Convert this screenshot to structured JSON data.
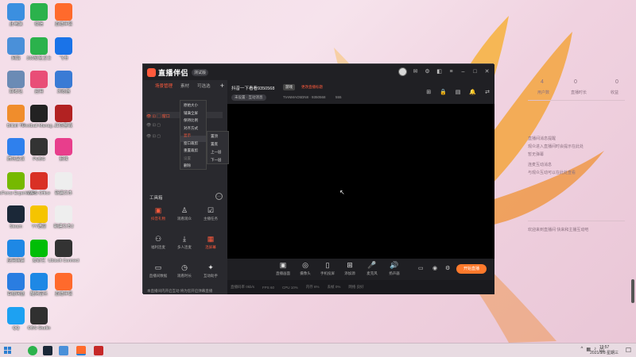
{
  "desktop_icons": [
    {
      "label": "此电脑",
      "icon": "computer-icon",
      "color": "#3b8fe0"
    },
    {
      "label": "微信",
      "icon": "wechat-icon",
      "color": "#2bb24c"
    },
    {
      "label": "直播伴侣",
      "icon": "live-companion-icon",
      "color": "#ff6a2c"
    },
    {
      "label": "网络",
      "icon": "network-icon",
      "color": "#4a90d9"
    },
    {
      "label": "360安全卫士",
      "icon": "shield-icon",
      "color": "#2bb24c"
    },
    {
      "label": "飞书",
      "icon": "feishu-icon",
      "color": "#1a73e8"
    },
    {
      "label": "回收站",
      "icon": "recycle-bin-icon",
      "color": "#6b8bb5"
    },
    {
      "label": "应用",
      "icon": "app-icon",
      "color": "#e94e77"
    },
    {
      "label": "浏览器",
      "icon": "browser-icon",
      "color": "#3a7bd5"
    },
    {
      "label": "Bilibili TV",
      "icon": "bilibili-icon",
      "color": "#f08d2c"
    },
    {
      "label": "Football Manag...",
      "icon": "football-icon",
      "color": "#222222"
    },
    {
      "label": "红色警戒",
      "icon": "game-icon",
      "color": "#b22222"
    },
    {
      "label": "腾讯会议",
      "icon": "meeting-icon",
      "color": "#2f80ed"
    },
    {
      "label": "PUBG",
      "icon": "pubg-icon",
      "color": "#333333"
    },
    {
      "label": "剪映",
      "icon": "capcut-icon",
      "color": "#e83e8c"
    },
    {
      "label": "GeForce Experience",
      "icon": "nvidia-icon",
      "color": "#76b900"
    },
    {
      "label": "WPS Office",
      "icon": "wps-icon",
      "color": "#d93025"
    },
    {
      "label": "新建文本",
      "icon": "document-icon",
      "color": "#eeeeee"
    },
    {
      "label": "Steam",
      "icon": "steam-icon",
      "color": "#1b2838"
    },
    {
      "label": "YY语音",
      "icon": "yy-icon",
      "color": "#f5c400"
    },
    {
      "label": "新建文本2",
      "icon": "document-icon",
      "color": "#eeeeee"
    },
    {
      "label": "应用商店",
      "icon": "store-icon",
      "color": "#1e88e5"
    },
    {
      "label": "爱奇艺",
      "icon": "iqiyi-icon",
      "color": "#00be06"
    },
    {
      "label": "Ubisoft Connect",
      "icon": "ubisoft-icon",
      "color": "#333333"
    },
    {
      "label": "百度网盘",
      "icon": "cloud-icon",
      "color": "#2a7de1"
    },
    {
      "label": "酷狗音乐",
      "icon": "kugou-icon",
      "color": "#1e88e5"
    },
    {
      "label": "直播伴侣",
      "icon": "live-companion-icon",
      "color": "#ff6a2c"
    },
    {
      "label": "QQ",
      "icon": "qq-icon",
      "color": "#1da1f2"
    },
    {
      "label": "OBS Studio",
      "icon": "obs-icon",
      "color": "#303030"
    }
  ],
  "app": {
    "logo_text": "直播伴侣",
    "version_badge": "测试版",
    "left_tabs": [
      "场景管理",
      "素材",
      "可选选"
    ],
    "tools_title": "工具箱",
    "tools": [
      {
        "label": "抖音礼物",
        "icon": "gift-icon",
        "active": true
      },
      {
        "label": "观看观众",
        "icon": "user-icon",
        "active": false
      },
      {
        "label": "主播任务",
        "icon": "task-icon",
        "active": false
      },
      {
        "label": "福利连麦",
        "icon": "link-icon",
        "active": false
      },
      {
        "label": "多人连麦",
        "icon": "download-icon",
        "active": false
      },
      {
        "label": "连屏幕",
        "icon": "screen-icon",
        "active": true
      },
      {
        "label": "直播间数据",
        "icon": "stats-icon",
        "active": false
      },
      {
        "label": "观看时长",
        "icon": "clock-icon",
        "active": false
      },
      {
        "label": "互动助手",
        "icon": "helper-icon",
        "active": false
      }
    ],
    "context_menu": [
      "原始大小",
      "铺满全屏",
      "保持比例",
      "对齐方式",
      "显示",
      "窗口裁剪",
      "重置裁剪",
      "设置",
      "删除"
    ],
    "submenu": [
      "置顶",
      "置底",
      "上一层",
      "下一层"
    ],
    "room_title": "抖音一下看看9350568",
    "category_badge": "游戏",
    "red_badge": "更改直播标题",
    "sub_pill": "未设置 · 互动消息",
    "room_id": "TIANMAO5DN8 · 9350568",
    "heat_label": "555",
    "bottom_tools": [
      {
        "label": "直播画面",
        "icon": "display-icon"
      },
      {
        "label": "摄像头",
        "icon": "camera-icon"
      },
      {
        "label": "手机投屏",
        "icon": "phone-icon"
      },
      {
        "label": "添加源",
        "icon": "add-source-icon"
      },
      {
        "label": "麦克风",
        "icon": "mic-icon"
      },
      {
        "label": "扬声器",
        "icon": "speaker-icon"
      }
    ],
    "start_button": "开始直播",
    "status_items": [
      "直播码率 0kb/s",
      "FPS 60",
      "CPU 10%",
      "内存 6%",
      "丢帧 0%",
      "网络 良好"
    ],
    "left_footer": "本直播间内开启互动 将为您开启弹幕直播"
  },
  "right_panel": {
    "stats": [
      "4",
      "0",
      "0"
    ],
    "stat_labels": [
      "用户数",
      "直播时长",
      "收益"
    ],
    "lines": [
      "直播间消息提醒",
      "观众进入直播间时会提示在此处",
      "暂无弹幕",
      "连麦互动消息",
      "与观众互动可以在此处查看"
    ],
    "footer": "欢迎来到直播间 快来和主播互动吧"
  },
  "taskbar": {
    "time": "19:57",
    "date": "2021/9/8 星期三"
  }
}
